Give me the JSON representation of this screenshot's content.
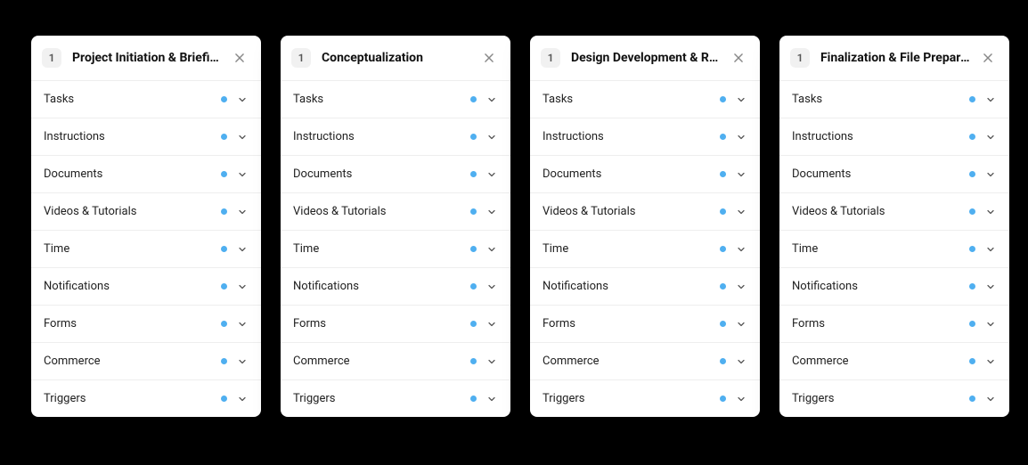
{
  "columns": [
    {
      "badge": "1",
      "title": "Project Initiation & Briefing",
      "sections": [
        {
          "label": "Tasks"
        },
        {
          "label": "Instructions"
        },
        {
          "label": "Documents"
        },
        {
          "label": "Videos & Tutorials"
        },
        {
          "label": "Time"
        },
        {
          "label": "Notifications"
        },
        {
          "label": "Forms"
        },
        {
          "label": "Commerce"
        },
        {
          "label": "Triggers"
        }
      ]
    },
    {
      "badge": "1",
      "title": "Conceptualization",
      "sections": [
        {
          "label": "Tasks"
        },
        {
          "label": "Instructions"
        },
        {
          "label": "Documents"
        },
        {
          "label": "Videos & Tutorials"
        },
        {
          "label": "Time"
        },
        {
          "label": "Notifications"
        },
        {
          "label": "Forms"
        },
        {
          "label": "Commerce"
        },
        {
          "label": "Triggers"
        }
      ]
    },
    {
      "badge": "1",
      "title": "Design Development & Refi..",
      "sections": [
        {
          "label": "Tasks"
        },
        {
          "label": "Instructions"
        },
        {
          "label": "Documents"
        },
        {
          "label": "Videos & Tutorials"
        },
        {
          "label": "Time"
        },
        {
          "label": "Notifications"
        },
        {
          "label": "Forms"
        },
        {
          "label": "Commerce"
        },
        {
          "label": "Triggers"
        }
      ]
    },
    {
      "badge": "1",
      "title": "Finalization & File Preparat..",
      "sections": [
        {
          "label": "Tasks"
        },
        {
          "label": "Instructions"
        },
        {
          "label": "Documents"
        },
        {
          "label": "Videos & Tutorials"
        },
        {
          "label": "Time"
        },
        {
          "label": "Notifications"
        },
        {
          "label": "Forms"
        },
        {
          "label": "Commerce"
        },
        {
          "label": "Triggers"
        }
      ]
    }
  ]
}
